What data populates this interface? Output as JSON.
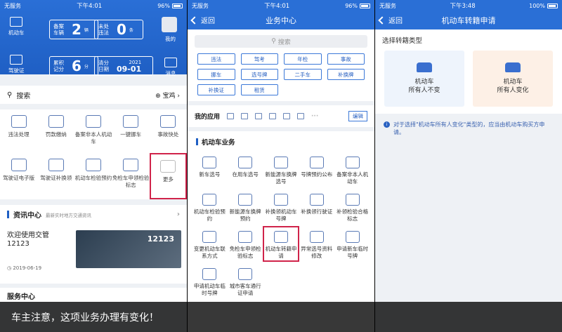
{
  "screen1": {
    "status": {
      "carrier": "无服务",
      "time": "下午4:01",
      "battery": "96%"
    },
    "left_icons": [
      {
        "label": "机动车"
      },
      {
        "label": "驾驶证"
      }
    ],
    "right_icons": [
      {
        "label": "我的"
      },
      {
        "label": "消息"
      }
    ],
    "plates": {
      "registered": {
        "label": "备案车辆",
        "value": "2",
        "unit": "辆"
      },
      "violations": {
        "label": "未处违法",
        "value": "0",
        "unit": "条"
      },
      "points": {
        "label": "累积记分",
        "value": "6",
        "unit": "分"
      },
      "clear_date": {
        "label": "清分日期",
        "year": "2021",
        "date": "09-01"
      }
    },
    "search": {
      "placeholder": "搜索",
      "city": "宝鸡"
    },
    "services_row1": [
      "违法处理",
      "罚款缴纳",
      "备案非本人机动车",
      "一键挪车",
      "事故快处"
    ],
    "services_row2": [
      "驾驶证电子版",
      "驾驶证补换领",
      "机动车检验预约",
      "免检车申领检验标志",
      "更多"
    ],
    "news": {
      "title": "资讯中心",
      "subtitle": "最新实时地方交通资讯",
      "text": "欢迎使用交管12123",
      "date": "2019-06-19",
      "image_text": "12123"
    },
    "bottom_section": "服务中心"
  },
  "screen2": {
    "status": {
      "carrier": "无服务",
      "time": "下午4:01",
      "battery": "96%"
    },
    "nav": {
      "back": "返回",
      "title": "业务中心"
    },
    "search_placeholder": "搜索",
    "tags": [
      "违法",
      "驾考",
      "年检",
      "事故",
      "挪车",
      "选号牌",
      "二手车",
      "补换牌",
      "补换证",
      "租赁"
    ],
    "my_apps": {
      "title": "我的应用",
      "edit": "编辑"
    },
    "section_title": "机动车业务",
    "services": [
      "新车选号",
      "在用车选号",
      "新能源车换牌选号",
      "号牌预约公布",
      "备案非本人机动车",
      "机动车检验预约",
      "新能源车换牌预约",
      "补换领机动车号牌",
      "补换领行驶证",
      "补领检验合格标志",
      "变更机动车联系方式",
      "免检车申领检验标志",
      "机动车转籍申请",
      "异常选号资料修改",
      "申请新车临时号牌",
      "申请机动车临时号牌",
      "城市客车通行证申请"
    ]
  },
  "screen3": {
    "status": {
      "carrier": "无服务",
      "time": "下午3:48",
      "battery": "100%"
    },
    "nav": {
      "back": "返回",
      "title": "机动车转籍申请"
    },
    "label": "选择转籍类型",
    "cards": [
      {
        "line1": "机动车",
        "line2": "所有人不变"
      },
      {
        "line1": "机动车",
        "line2": "所有人变化"
      }
    ],
    "note": "对于选择\"机动车所有人变化\"类型的，应当由机动车购买方申请。"
  },
  "caption": "车主注意，这项业务办理有变化！"
}
